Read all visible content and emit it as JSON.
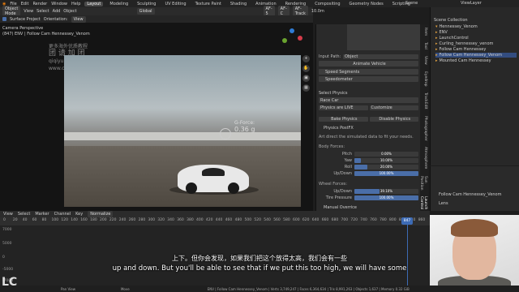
{
  "menu": {
    "file": "File",
    "edit": "Edit",
    "render": "Render",
    "window": "Window",
    "help": "Help",
    "workspaces": [
      "Layout",
      "Modeling",
      "Sculpting",
      "UV Editing",
      "Texture Paint",
      "Shading",
      "Animation",
      "Rendering",
      "Compositing",
      "Geometry Nodes",
      "Scripting"
    ],
    "scene": "Scene",
    "view_layer": "ViewLayer"
  },
  "viewport_header": {
    "mode": "Object Mode",
    "view": "View",
    "select": "Select",
    "add": "Add",
    "object": "Object",
    "transform": "Global",
    "tool_af5": "AF-5",
    "tool_afc": "AF-C",
    "tool_track": "AF-Track",
    "focal": "10.0m"
  },
  "viewport_header2": {
    "surface_project": "Surface Project",
    "orientation": "Orientation:",
    "view": "View"
  },
  "viewport": {
    "camera_label": "Camera Perspective",
    "object_label": "(847) ENV | Follow Cam Hennessey_Venom",
    "gforce_title": "G-Force:",
    "gforce_value": "0.36 g",
    "watermark_1": "更多海外优质教程",
    "watermark_2": "团 请 加 团",
    "watermark_3": "qiqiyu 12",
    "watermark_4": "www.cgtig.com"
  },
  "properties": {
    "input_path_label": "Input Path:",
    "input_path_value": "Object",
    "animate_vehicle": "Animate Vehicle",
    "speed_segments": "Speed Segments",
    "speedometer": "Speedometer",
    "select_physics": "Select Physics",
    "physics_type": "Race Car",
    "physics_live": "Physics are LIVE",
    "customize": "Customize",
    "bake_physics": "Bake Physics",
    "disable_physics": "Disable Physics",
    "physics_postfx": "Physics PostFX",
    "postfx_desc": "Art direct the simulated data to fit your needs.",
    "body_forces": "Body Forces:",
    "pitch": {
      "label": "Pitch",
      "value": "0.00%",
      "pct": 0
    },
    "yaw": {
      "label": "Yaw",
      "value": "10.00%",
      "pct": 10
    },
    "roll": {
      "label": "Roll",
      "value": "20.00%",
      "pct": 20
    },
    "updown": {
      "label": "Up/Down",
      "value": "100.00%",
      "pct": 100
    },
    "wheel_forces": "Wheel Forces:",
    "wheel_updown": {
      "label": "Up/Down",
      "value": "39.10%",
      "pct": 39.1
    },
    "tire_pressure": {
      "label": "Tire Pressure",
      "value": "100.00%",
      "pct": 100
    },
    "manual_overrice": "Manual Overrice"
  },
  "side_tabs": [
    "Item",
    "Tool",
    "View",
    "Eyedrop",
    "TrackEdit",
    "Photographer",
    "Atmosphere",
    "Sun Position",
    "Launch Control"
  ],
  "outliner": {
    "scene_collection": "Scene Collection",
    "items": [
      "Hennessey_Venom",
      "ENV",
      "LaunchControl",
      "Curling_hennessey_venom",
      "Follow Cam Hennessey",
      "Follow Cam Hennessey_Venom",
      "Mounted Cam Hennessey"
    ],
    "selected_index": 5
  },
  "outliner_props": {
    "object": "Follow Cam Hennessey_Venom",
    "lens": "Lens"
  },
  "timeline": {
    "view": "View",
    "select": "Select",
    "marker": "Marker",
    "channel": "Channel",
    "key": "Key",
    "normalize": "Normalize",
    "ticks": [
      "0",
      "20",
      "40",
      "60",
      "80",
      "100",
      "120",
      "140",
      "160",
      "180",
      "200",
      "220",
      "240",
      "260",
      "280",
      "300",
      "320",
      "340",
      "360",
      "380",
      "400",
      "420",
      "440",
      "460",
      "480",
      "500",
      "520",
      "540",
      "560",
      "580",
      "600",
      "620",
      "640",
      "660",
      "680",
      "700",
      "720",
      "740",
      "760",
      "780",
      "800",
      "820",
      "840",
      "860"
    ],
    "current_frame": "847",
    "y_labels": [
      "7000",
      "5000",
      "0",
      "-5000",
      "-7000"
    ]
  },
  "status": {
    "pan_view": "Pan View",
    "move": "Move",
    "info": "ENV | Follow Cam Hennessey_Venom | Verts 3,749,247 | Faces 6,364,634 | Tris 8,991,263 | Objects 1,637 | Memory 0.32 GiB"
  },
  "subtitles": {
    "zh": "上下。但你会发现，如果我们把这个放得太高，我们会有一些",
    "en": "up and down. But you'll be able to see that if we put this too high, we will have some"
  },
  "logo_text": "LC"
}
